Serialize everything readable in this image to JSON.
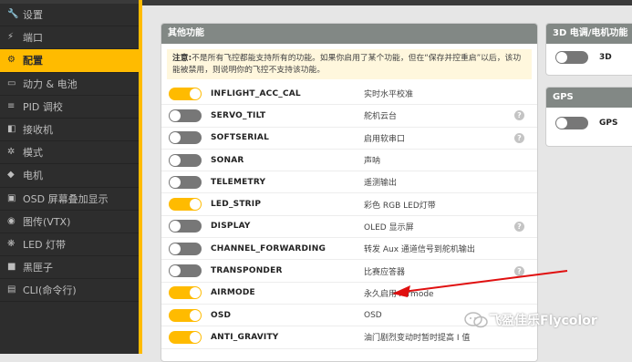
{
  "sidebar": {
    "items": [
      {
        "label": "设置",
        "icon": "wrench-icon",
        "active": false
      },
      {
        "label": "端口",
        "icon": "plug-icon",
        "active": false
      },
      {
        "label": "配置",
        "icon": "gear-icon",
        "active": true
      },
      {
        "label": "动力 & 电池",
        "icon": "battery-icon",
        "active": false
      },
      {
        "label": "PID 调校",
        "icon": "sliders-icon",
        "active": false
      },
      {
        "label": "接收机",
        "icon": "receiver-icon",
        "active": false
      },
      {
        "label": "模式",
        "icon": "cog-icon",
        "active": false
      },
      {
        "label": "电机",
        "icon": "motor-icon",
        "active": false
      },
      {
        "label": "OSD 屏幕叠加显示",
        "icon": "osd-icon",
        "active": false
      },
      {
        "label": "图传(VTX)",
        "icon": "antenna-icon",
        "active": false
      },
      {
        "label": "LED 灯带",
        "icon": "led-icon",
        "active": false
      },
      {
        "label": "黑匣子",
        "icon": "blackbox-icon",
        "active": false
      },
      {
        "label": "CLI(命令行)",
        "icon": "terminal-icon",
        "active": false
      }
    ]
  },
  "other_features": {
    "title": "其他功能",
    "note_prefix": "注意:",
    "note_text": "不是所有飞控都能支持所有的功能。如果你启用了某个功能，但在“保存并控重启”以后，该功能被禁用，则说明你的飞控不支持该功能。",
    "features": [
      {
        "name": "INFLIGHT_ACC_CAL",
        "desc": "实时水平校准",
        "enabled": true,
        "help": false
      },
      {
        "name": "SERVO_TILT",
        "desc": "舵机云台",
        "enabled": false,
        "help": true
      },
      {
        "name": "SOFTSERIAL",
        "desc": "启用软串口",
        "enabled": false,
        "help": true
      },
      {
        "name": "SONAR",
        "desc": "声呐",
        "enabled": false,
        "help": false
      },
      {
        "name": "TELEMETRY",
        "desc": "遥测输出",
        "enabled": false,
        "help": false
      },
      {
        "name": "LED_STRIP",
        "desc": "彩色 RGB LED灯带",
        "enabled": true,
        "help": false
      },
      {
        "name": "DISPLAY",
        "desc": "OLED 显示屏",
        "enabled": false,
        "help": true
      },
      {
        "name": "CHANNEL_FORWARDING",
        "desc": "转发 Aux 通道信号到舵机输出",
        "enabled": false,
        "help": false
      },
      {
        "name": "TRANSPONDER",
        "desc": "比赛应答器",
        "enabled": false,
        "help": true
      },
      {
        "name": "AIRMODE",
        "desc": "永久启用 Airmode",
        "enabled": true,
        "help": false
      },
      {
        "name": "OSD",
        "desc": "OSD",
        "enabled": true,
        "help": false
      },
      {
        "name": "ANTI_GRAVITY",
        "desc": "油门剧烈变动时暂时提高 I 值",
        "enabled": true,
        "help": false
      }
    ]
  },
  "esc_panel": {
    "title": "3D 电调/电机功能",
    "feature": "3D",
    "enabled": false
  },
  "gps_panel": {
    "title": "GPS",
    "feature": "GPS",
    "enabled": false
  },
  "watermark": {
    "text": "飞盈佳乐Flycolor"
  },
  "colors": {
    "accent": "#ffbb00",
    "sidebar": "#2d2d2d",
    "arrow": "#e01010"
  }
}
